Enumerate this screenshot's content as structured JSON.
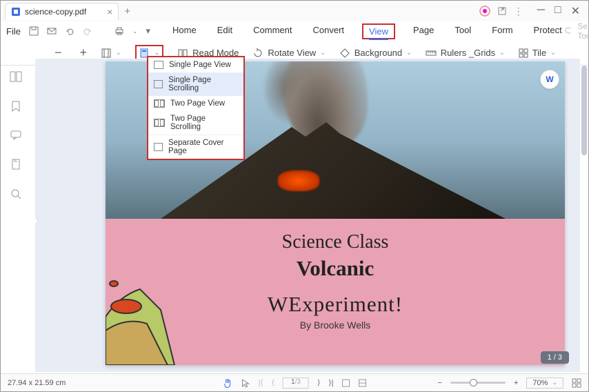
{
  "tab": {
    "title": "science-copy.pdf"
  },
  "menubar": {
    "file": "File",
    "items": [
      "Home",
      "Edit",
      "Comment",
      "Convert",
      "View",
      "Page",
      "Tool",
      "Form",
      "Protect"
    ],
    "active_index": 4,
    "search_placeholder": "Search Tools"
  },
  "toolbar": {
    "read_mode": "Read Mode",
    "rotate": "Rotate View",
    "background": "Background",
    "rulers": "Rulers _Grids",
    "tile": "Tile"
  },
  "dropdown": {
    "items": [
      "Single Page View",
      "Single Page Scrolling",
      "Two Page View",
      "Two Page Scrolling",
      "Separate Cover Page"
    ],
    "selected_index": 1
  },
  "document": {
    "heading1": "Science Class",
    "heading2": "Volcanic",
    "heading3_overlay": "WExperiment!",
    "byline": "By Brooke Wells"
  },
  "page_indicator": "1 / 3",
  "status": {
    "dimensions": "27.94 x 21.59 cm",
    "page_current": "1",
    "page_total": "/3",
    "zoom": "70%"
  }
}
